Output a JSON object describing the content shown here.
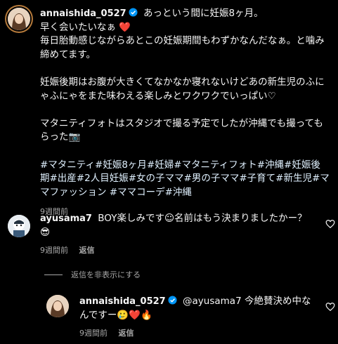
{
  "post": {
    "username": "annaishida_0527",
    "lines": [
      "あっという間に妊娠8ヶ月。",
      "早く会いたいなぁ ❤️",
      "毎日胎動感じながらあとこの妊娠期間もわずかなんだなぁ。と噛み締めてます。",
      "",
      "妊娠後期はお腹が大きくてなかなか寝れないけどあの新生児のふにゃふにゃをまた味わえる楽しみとワクワクでいっぱい♡",
      "",
      "マタニティフォトはスタジオで撮る予定でしたが沖縄でも撮ってもらった📷",
      "",
      "#マタニティ#妊娠8ヶ月#妊婦#マタニティフォト#沖縄#妊娠後期#出産#2人目妊娠#女の子ママ#男の子ママ#子育て#新生児#ママファッション #ママコーデ#沖縄"
    ],
    "time": "9週間前"
  },
  "comment": {
    "username": "ayusama7",
    "text": "BOY楽しみです☺︎名前はもう決まりましたかー？😎",
    "time": "9週間前",
    "reply_label": "返信"
  },
  "replies_toggle": {
    "label": "返信を非表示にする"
  },
  "reply": {
    "username": "annaishida_0527",
    "text": "@ayusama7 今絶賛決め中なんですー🥲❤️🔥",
    "time": "9週間前",
    "reply_label": "返信"
  }
}
